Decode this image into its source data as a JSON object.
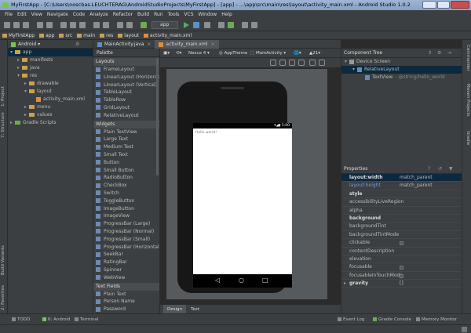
{
  "window": {
    "title": "MyFirstApp - [C:\\Users\\noscbas.LEUCHTERAG\\AndroidStudioProjects\\MyFirstApp] - [app] - ...\\app\\src\\main\\res\\layout\\activity_main.xml - Android Studio 1.0.2"
  },
  "menu": [
    "File",
    "Edit",
    "View",
    "Navigate",
    "Code",
    "Analyze",
    "Refactor",
    "Build",
    "Run",
    "Tools",
    "VCS",
    "Window",
    "Help"
  ],
  "toolbar": {
    "run_config": "app"
  },
  "breadcrumbs": [
    "MyFirstApp",
    "app",
    "src",
    "main",
    "res",
    "layout",
    "activity_main.xml"
  ],
  "project": {
    "view_mode": "Android",
    "tree": [
      {
        "label": "app",
        "depth": 0,
        "kind": "folder",
        "expanded": true,
        "selected": true
      },
      {
        "label": "manifests",
        "depth": 1,
        "kind": "folder"
      },
      {
        "label": "java",
        "depth": 1,
        "kind": "folder"
      },
      {
        "label": "res",
        "depth": 1,
        "kind": "folder",
        "expanded": true
      },
      {
        "label": "drawable",
        "depth": 2,
        "kind": "folder"
      },
      {
        "label": "layout",
        "depth": 2,
        "kind": "folder",
        "expanded": true
      },
      {
        "label": "activity_main.xml",
        "depth": 3,
        "kind": "file"
      },
      {
        "label": "menu",
        "depth": 2,
        "kind": "folder"
      },
      {
        "label": "values",
        "depth": 2,
        "kind": "folder"
      },
      {
        "label": "Gradle Scripts",
        "depth": 0,
        "kind": "gradle"
      }
    ]
  },
  "tool_windows": {
    "project": "1: Project",
    "structure": "7: Structure",
    "build_variants": "Build Variants",
    "favorites": "2: Favorites",
    "commander": "Commander",
    "maven": "Maven Projects",
    "gradle": "Gradle"
  },
  "editor_tabs": [
    {
      "label": "MainActivity.java",
      "active": false
    },
    {
      "label": "activity_main.xml",
      "active": true
    }
  ],
  "palette": {
    "title": "Palette",
    "sections": [
      {
        "name": "Layouts",
        "items": [
          "FrameLayout",
          "LinearLayout (Horizontal)",
          "LinearLayout (Vertical)",
          "TableLayout",
          "TableRow",
          "GridLayout",
          "RelativeLayout"
        ]
      },
      {
        "name": "Widgets",
        "items": [
          "Plain TextView",
          "Large Text",
          "Medium Text",
          "Small Text",
          "Button",
          "Small Button",
          "RadioButton",
          "CheckBox",
          "Switch",
          "ToggleButton",
          "ImageButton",
          "ImageView",
          "ProgressBar (Large)",
          "ProgressBar (Normal)",
          "ProgressBar (Small)",
          "ProgressBar (Horizontal)",
          "SeekBar",
          "RatingBar",
          "Spinner",
          "WebView"
        ]
      },
      {
        "name": "Text Fields",
        "items": [
          "Plain Text",
          "Person Name",
          "Password"
        ]
      }
    ]
  },
  "designer": {
    "device": "Nexus 4",
    "theme": "AppTheme",
    "activity": "MainActivity",
    "api": "21",
    "time": "5:00",
    "hello_text": "Hello world!",
    "tabs": [
      "Design",
      "Text"
    ],
    "active_tab": "Design"
  },
  "component_tree": {
    "title": "Component Tree",
    "rows": [
      {
        "label": "Device Screen",
        "depth": 0
      },
      {
        "label": "RelativeLayout",
        "depth": 1,
        "selected": true
      },
      {
        "label": "TextView",
        "extra": "- @string/hello_world",
        "depth": 2
      }
    ]
  },
  "properties": {
    "title": "Properties",
    "rows": [
      {
        "name": "layout:width",
        "value": "match_parent",
        "style": "req",
        "selected": true
      },
      {
        "name": "layout:height",
        "value": "match_parent",
        "style": "set"
      },
      {
        "name": "style",
        "value": "",
        "style": "req"
      },
      {
        "name": "accessibilityLiveRegion",
        "value": ""
      },
      {
        "name": "alpha",
        "value": ""
      },
      {
        "name": "background",
        "value": "",
        "style": "req"
      },
      {
        "name": "backgroundTint",
        "value": ""
      },
      {
        "name": "backgroundTintMode",
        "value": ""
      },
      {
        "name": "clickable",
        "value": "",
        "check": true
      },
      {
        "name": "contentDescription",
        "value": ""
      },
      {
        "name": "elevation",
        "value": ""
      },
      {
        "name": "focusable",
        "value": "",
        "check": true
      },
      {
        "name": "focusableInTouchMode",
        "value": "",
        "check": true
      },
      {
        "name": "gravity",
        "value": "[]",
        "style": "req",
        "expander": true
      }
    ]
  },
  "status": {
    "todo": "TODO",
    "android": "6: Android",
    "terminal": "Terminal",
    "event_log": "Event Log",
    "gradle_console": "Gradle Console",
    "memory_monitor": "Memory Monitor"
  },
  "colors": {
    "accent": "#4b6eaf",
    "selection": "#0d293e"
  }
}
